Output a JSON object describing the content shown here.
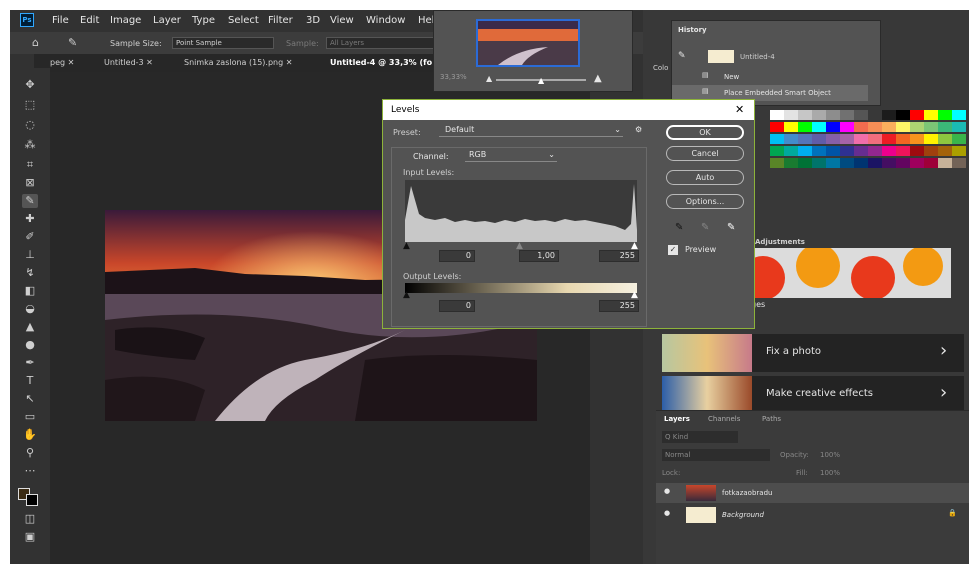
{
  "menubar": {
    "logo": "Ps",
    "items": [
      "File",
      "Edit",
      "Image",
      "Layer",
      "Type",
      "Select",
      "Filter",
      "3D",
      "View",
      "Window",
      "Hel"
    ],
    "window_controls": [
      "—",
      "□",
      "✕"
    ]
  },
  "options_bar": {
    "sample_size_label": "Sample Size:",
    "sample_size_value": "Point Sample",
    "sample_label": "Sample:",
    "sample_value": "All Layers"
  },
  "tabs": [
    {
      "label": "peg",
      "close": "✕"
    },
    {
      "label": "Untitled-3",
      "close": "✕"
    },
    {
      "label": "Snimka zaslona (15).png",
      "close": "✕"
    },
    {
      "label": "Untitled-4 @ 33,3% (fo",
      "close": ""
    }
  ],
  "navigator": {
    "zoom": "33,33%"
  },
  "history": {
    "title": "History",
    "snapshot_label": "Untitled-4",
    "steps": [
      "New",
      "Place Embedded Smart Object"
    ]
  },
  "color_panel": {
    "tab_label": "Colo"
  },
  "swatches": {
    "colors": [
      [
        "#ffffff",
        "#e3e3e3",
        "#c6c6c6",
        "#aaaaaa",
        "#8d8d8d",
        "#717171",
        "#555555",
        "#383838",
        "#1c1c1c",
        "#000000",
        "#ff0000",
        "#ffff00",
        "#00ff00",
        "#00ffff"
      ],
      [
        "#ff0000",
        "#ffff00",
        "#00ff00",
        "#00ffff",
        "#0000ff",
        "#ff00ff",
        "#f26c4f",
        "#f68e56",
        "#fbaf5d",
        "#fff568",
        "#acd372",
        "#7cc576",
        "#3bb878",
        "#1abbb4"
      ],
      [
        "#00bff3",
        "#438ccb",
        "#5574b9",
        "#605ca8",
        "#855fa8",
        "#a763a8",
        "#f06eaa",
        "#f26d7d",
        "#ed1c24",
        "#f26522",
        "#f7941d",
        "#fff200",
        "#8dc73f",
        "#39b54a"
      ],
      [
        "#00a651",
        "#00a99d",
        "#00aeef",
        "#0072bc",
        "#0054a6",
        "#2e3192",
        "#662d91",
        "#92278f",
        "#ec008c",
        "#ed145b",
        "#9e0b0f",
        "#a0410d",
        "#a3620a",
        "#aba000"
      ],
      [
        "#598527",
        "#197b30",
        "#007236",
        "#00746b",
        "#0076a3",
        "#004b80",
        "#003471",
        "#1b1464",
        "#440e62",
        "#630460",
        "#9e005d",
        "#9e0039",
        "#c7b299",
        "#736357"
      ]
    ]
  },
  "learn": {
    "cards": [
      {
        "label": "Fix a photo",
        "arrow": "›"
      },
      {
        "label": "Make creative effects",
        "arrow": "›"
      }
    ],
    "partial_text": "ges",
    "adjustments_label": "Adjustments"
  },
  "layers": {
    "tabs": [
      "Layers",
      "Channels",
      "Paths"
    ],
    "kind_label": "Q Kind",
    "blend_mode": "Normal",
    "opacity_label": "Opacity:",
    "opacity_value": "100%",
    "lock_label": "Lock:",
    "fill_label": "Fill:",
    "fill_value": "100%",
    "rows": [
      {
        "name": "fotkazaobradu",
        "selected": true
      },
      {
        "name": "Background",
        "selected": false
      }
    ]
  },
  "levels_dialog": {
    "title": "Levels",
    "close": "✕",
    "preset_label": "Preset:",
    "preset_value": "Default",
    "channel_label": "Channel:",
    "channel_value": "RGB",
    "input_levels_label": "Input Levels:",
    "input_black": "0",
    "input_gamma": "1,00",
    "input_white": "255",
    "output_levels_label": "Output Levels:",
    "output_black": "0",
    "output_white": "255",
    "buttons": {
      "ok": "OK",
      "cancel": "Cancel",
      "auto": "Auto",
      "options": "Options..."
    },
    "preview_label": "Preview",
    "preview_checked": true
  },
  "colors": {
    "accent": "#31a8ff",
    "dialog_border": "#8db33a",
    "bg": "#323232"
  }
}
